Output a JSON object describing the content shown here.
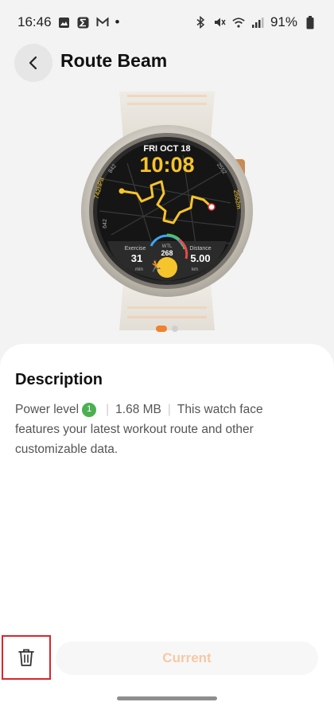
{
  "status_bar": {
    "time": "16:46",
    "dot": "•",
    "battery": "91%"
  },
  "header": {
    "title": "Route Beam",
    "back_icon": "chevron-left-icon"
  },
  "watch_face": {
    "date": "FRI OCT 18",
    "time": "10:08",
    "left_stat": "742hPa",
    "left_small": "842",
    "right_small": "2552",
    "right_stat": "2552m",
    "bottom_left_small": "642",
    "exercise_label": "Exercise",
    "exercise_value": "31",
    "exercise_unit": "min",
    "wtl_label": "WTL",
    "wtl_value": "268",
    "distance_label": "Distance",
    "distance_value": "5.00",
    "distance_unit": "km"
  },
  "pager": {
    "active": 1,
    "total": 2
  },
  "description": {
    "title": "Description",
    "power_label": "Power level",
    "power_value": "1",
    "size": "1.68 MB",
    "text": "This watch face features your latest workout route and other customizable data."
  },
  "actions": {
    "delete_icon": "trash-icon",
    "current_label": "Current"
  },
  "colors": {
    "accent": "#f0822e",
    "power_badge": "#4caf50",
    "highlight_border": "#d9262b"
  }
}
